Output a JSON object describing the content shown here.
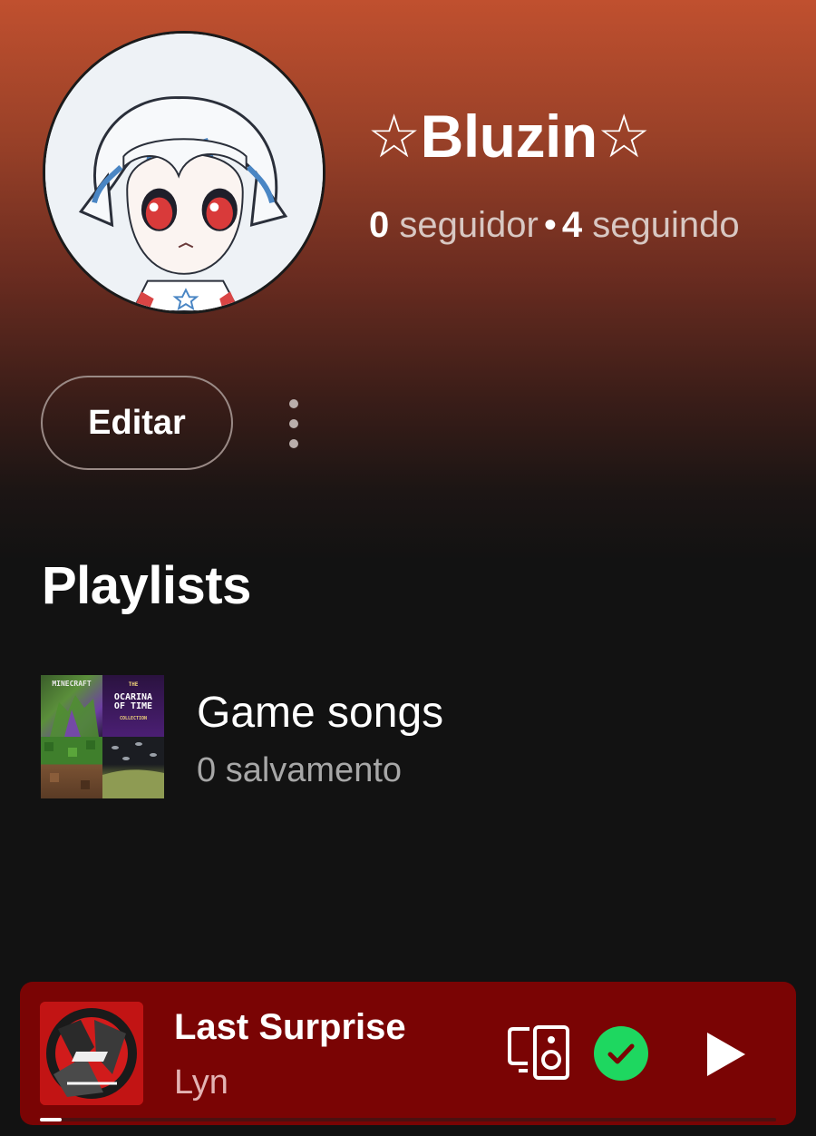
{
  "profile": {
    "name": "☆Bluzin☆",
    "followers_count": "0",
    "followers_label": "seguidor",
    "separator": "•",
    "following_count": "4",
    "following_label": "seguindo",
    "avatar_icon": "anime-avatar-image"
  },
  "actions": {
    "edit_label": "Editar",
    "more_icon": "more-vertical-icon"
  },
  "playlists_section": {
    "title": "Playlists",
    "items": [
      {
        "title": "Game songs",
        "meta": "0 salvamento",
        "cover_tiles": [
          {
            "name": "minecraft-cover",
            "text": "MINECRAFT"
          },
          {
            "name": "ocarina-of-time-cover",
            "text_top": "THE",
            "text_main": "OCARINA OF TIME",
            "text_bottom": "COLLECTION"
          },
          {
            "name": "minecraft-grass-cover"
          },
          {
            "name": "dark-landscape-cover"
          }
        ]
      }
    ]
  },
  "now_playing": {
    "title": "Last Surprise",
    "artist": "Lyn",
    "progress_fraction": 0.03,
    "devices_icon": "connect-devices-icon",
    "added_icon": "check-circle-icon",
    "play_icon": "play-icon",
    "colors": {
      "background": "#7a0404",
      "added_green": "#1ed760"
    }
  },
  "colors": {
    "gradient_top": "#c0502f",
    "background": "#121212",
    "secondary_text": "#a7a7a7"
  }
}
